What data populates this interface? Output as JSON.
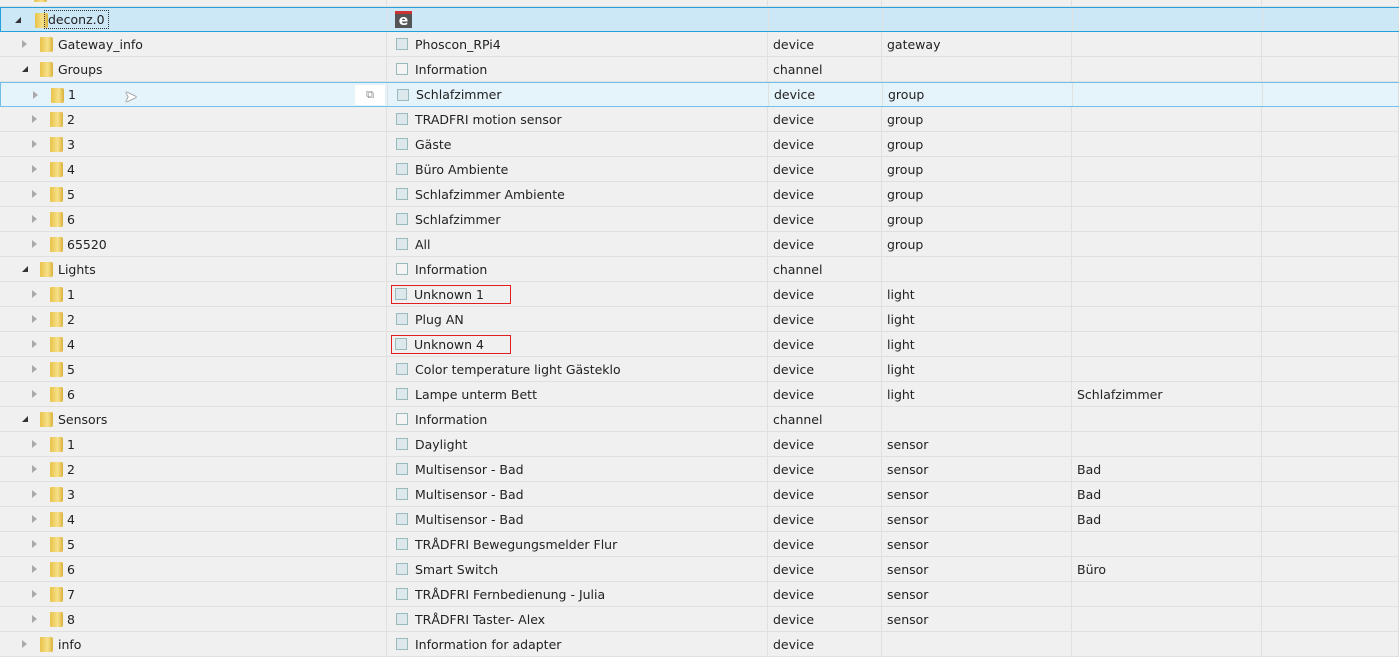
{
  "rows": [
    {
      "level": 0,
      "open": false,
      "name": "",
      "title": "",
      "type": "",
      "role": "",
      "room": "",
      "partial": true
    },
    {
      "level": 0,
      "open": true,
      "name": "deconz.0",
      "icon": "deconz-logo",
      "title": "",
      "type": "",
      "role": "",
      "room": "",
      "selected": true
    },
    {
      "level": 1,
      "open": false,
      "name": "Gateway_info",
      "icon": "device",
      "title": "Phoscon_RPi4",
      "type": "device",
      "role": "gateway",
      "room": ""
    },
    {
      "level": 1,
      "open": true,
      "name": "Groups",
      "icon": "channel",
      "title": "Information",
      "type": "channel",
      "role": "",
      "room": ""
    },
    {
      "level": 2,
      "open": false,
      "name": "1",
      "icon": "device",
      "title": "Schlafzimmer",
      "type": "device",
      "role": "group",
      "room": "",
      "hover": true
    },
    {
      "level": 2,
      "open": false,
      "name": "2",
      "icon": "device",
      "title": "TRADFRI motion sensor",
      "type": "device",
      "role": "group",
      "room": ""
    },
    {
      "level": 2,
      "open": false,
      "name": "3",
      "icon": "device",
      "title": "Gäste",
      "type": "device",
      "role": "group",
      "room": ""
    },
    {
      "level": 2,
      "open": false,
      "name": "4",
      "icon": "device",
      "title": "Büro Ambiente",
      "type": "device",
      "role": "group",
      "room": ""
    },
    {
      "level": 2,
      "open": false,
      "name": "5",
      "icon": "device",
      "title": "Schlafzimmer Ambiente",
      "type": "device",
      "role": "group",
      "room": ""
    },
    {
      "level": 2,
      "open": false,
      "name": "6",
      "icon": "device",
      "title": "Schlafzimmer",
      "type": "device",
      "role": "group",
      "room": ""
    },
    {
      "level": 2,
      "open": false,
      "name": "65520",
      "icon": "device",
      "title": "All",
      "type": "device",
      "role": "group",
      "room": ""
    },
    {
      "level": 1,
      "open": true,
      "name": "Lights",
      "icon": "channel",
      "title": "Information",
      "type": "channel",
      "role": "",
      "room": ""
    },
    {
      "level": 2,
      "open": false,
      "name": "1",
      "icon": "device",
      "title": "Unknown 1",
      "type": "device",
      "role": "light",
      "room": "",
      "highlight": true
    },
    {
      "level": 2,
      "open": false,
      "name": "2",
      "icon": "device",
      "title": "Plug AN",
      "type": "device",
      "role": "light",
      "room": ""
    },
    {
      "level": 2,
      "open": false,
      "name": "4",
      "icon": "device",
      "title": "Unknown 4",
      "type": "device",
      "role": "light",
      "room": "",
      "highlight": true
    },
    {
      "level": 2,
      "open": false,
      "name": "5",
      "icon": "device",
      "title": "Color temperature light Gästeklo",
      "type": "device",
      "role": "light",
      "room": ""
    },
    {
      "level": 2,
      "open": false,
      "name": "6",
      "icon": "device",
      "title": "Lampe unterm Bett",
      "type": "device",
      "role": "light",
      "room": "Schlafzimmer"
    },
    {
      "level": 1,
      "open": true,
      "name": "Sensors",
      "icon": "channel",
      "title": "Information",
      "type": "channel",
      "role": "",
      "room": ""
    },
    {
      "level": 2,
      "open": false,
      "name": "1",
      "icon": "device",
      "title": "Daylight",
      "type": "device",
      "role": "sensor",
      "room": ""
    },
    {
      "level": 2,
      "open": false,
      "name": "2",
      "icon": "device",
      "title": "Multisensor - Bad",
      "type": "device",
      "role": "sensor",
      "room": "Bad"
    },
    {
      "level": 2,
      "open": false,
      "name": "3",
      "icon": "device",
      "title": "Multisensor - Bad",
      "type": "device",
      "role": "sensor",
      "room": "Bad"
    },
    {
      "level": 2,
      "open": false,
      "name": "4",
      "icon": "device",
      "title": "Multisensor - Bad",
      "type": "device",
      "role": "sensor",
      "room": "Bad"
    },
    {
      "level": 2,
      "open": false,
      "name": "5",
      "icon": "device",
      "title": "TRÅDFRI Bewegungsmelder Flur",
      "type": "device",
      "role": "sensor",
      "room": ""
    },
    {
      "level": 2,
      "open": false,
      "name": "6",
      "icon": "device",
      "title": "Smart Switch",
      "type": "device",
      "role": "sensor",
      "room": "Büro"
    },
    {
      "level": 2,
      "open": false,
      "name": "7",
      "icon": "device",
      "title": "TRÅDFRI Fernbedienung - Julia",
      "type": "device",
      "role": "sensor",
      "room": ""
    },
    {
      "level": 2,
      "open": false,
      "name": "8",
      "icon": "device",
      "title": "TRÅDFRI Taster- Alex",
      "type": "device",
      "role": "sensor",
      "room": ""
    },
    {
      "level": 1,
      "open": false,
      "name": "info",
      "icon": "device",
      "title": "Information for adapter",
      "type": "device",
      "role": "",
      "room": ""
    }
  ],
  "deconz_logo_letter": "e",
  "copy_icon": "⧉"
}
